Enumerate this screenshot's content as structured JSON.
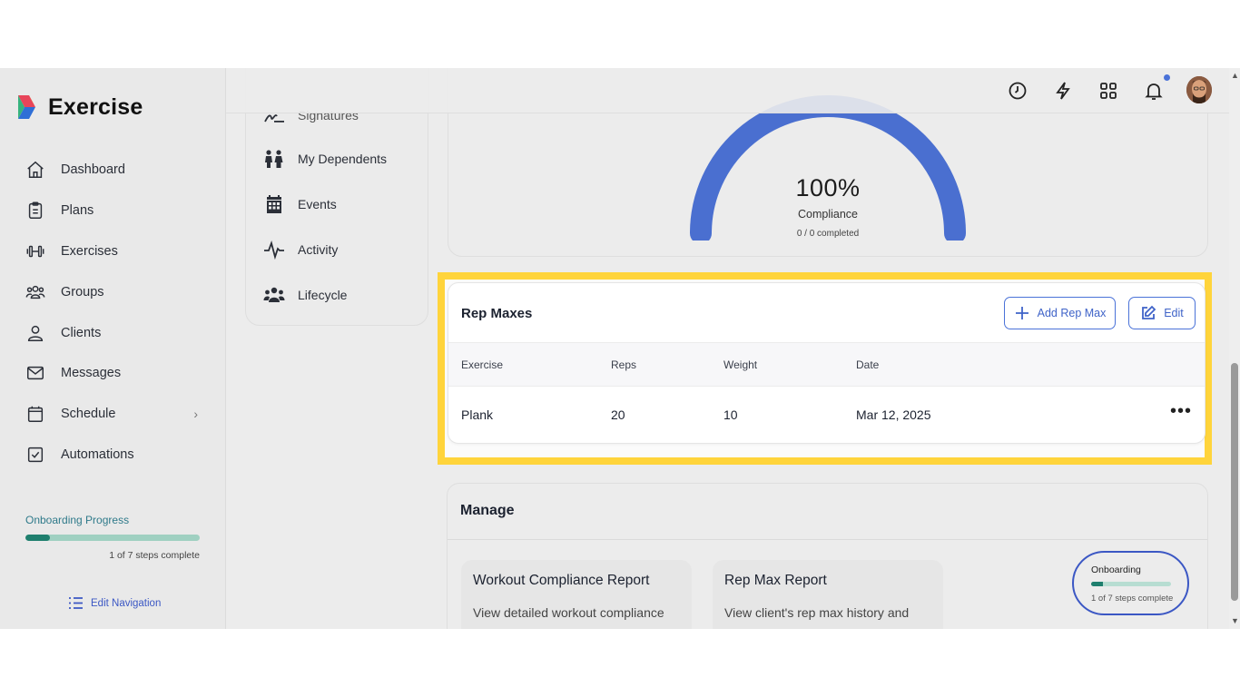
{
  "app": {
    "name": "Exercise"
  },
  "sidebar": {
    "items": [
      {
        "label": "Dashboard",
        "icon": "home-icon"
      },
      {
        "label": "Plans",
        "icon": "clipboard-icon"
      },
      {
        "label": "Exercises",
        "icon": "dumbbell-icon"
      },
      {
        "label": "Groups",
        "icon": "group-icon"
      },
      {
        "label": "Clients",
        "icon": "user-icon"
      },
      {
        "label": "Messages",
        "icon": "mail-icon"
      },
      {
        "label": "Schedule",
        "icon": "calendar-icon"
      },
      {
        "label": "Automations",
        "icon": "checkbox-icon"
      }
    ],
    "onboarding": {
      "title": "Onboarding Progress",
      "steps_text": "1 of 7 steps complete",
      "progress": 0.143
    },
    "edit_nav_label": "Edit Navigation"
  },
  "client_menu": {
    "items": [
      {
        "label": "Signatures",
        "icon": "signature-icon"
      },
      {
        "label": "My Dependents",
        "icon": "dependents-icon"
      },
      {
        "label": "Events",
        "icon": "calendar-grid-icon"
      },
      {
        "label": "Activity",
        "icon": "activity-icon"
      },
      {
        "label": "Lifecycle",
        "icon": "lifecycle-icon"
      }
    ]
  },
  "compliance": {
    "value": "100%",
    "label": "Compliance",
    "sub": "0 / 0 completed",
    "ratio": 1.0,
    "color": "#4a6fd0"
  },
  "rep_maxes": {
    "title": "Rep Maxes",
    "add_label": "Add Rep Max",
    "edit_label": "Edit",
    "columns": [
      "Exercise",
      "Reps",
      "Weight",
      "Date"
    ],
    "rows": [
      {
        "exercise": "Plank",
        "reps": "20",
        "weight": "10",
        "date": "Mar 12, 2025",
        "actions": "•••"
      }
    ]
  },
  "manage": {
    "title": "Manage",
    "reports": [
      {
        "title": "Workout Compliance Report",
        "desc": "View detailed workout compliance"
      },
      {
        "title": "Rep Max Report",
        "desc": "View client's rep max history and"
      }
    ]
  },
  "onboarding_widget": {
    "title": "Onboarding",
    "steps_text": "1 of 7 steps complete",
    "progress": 0.143
  },
  "colors": {
    "accent": "#4a72d8",
    "highlight": "#ffd43b",
    "progress": "#1f7f6e"
  }
}
